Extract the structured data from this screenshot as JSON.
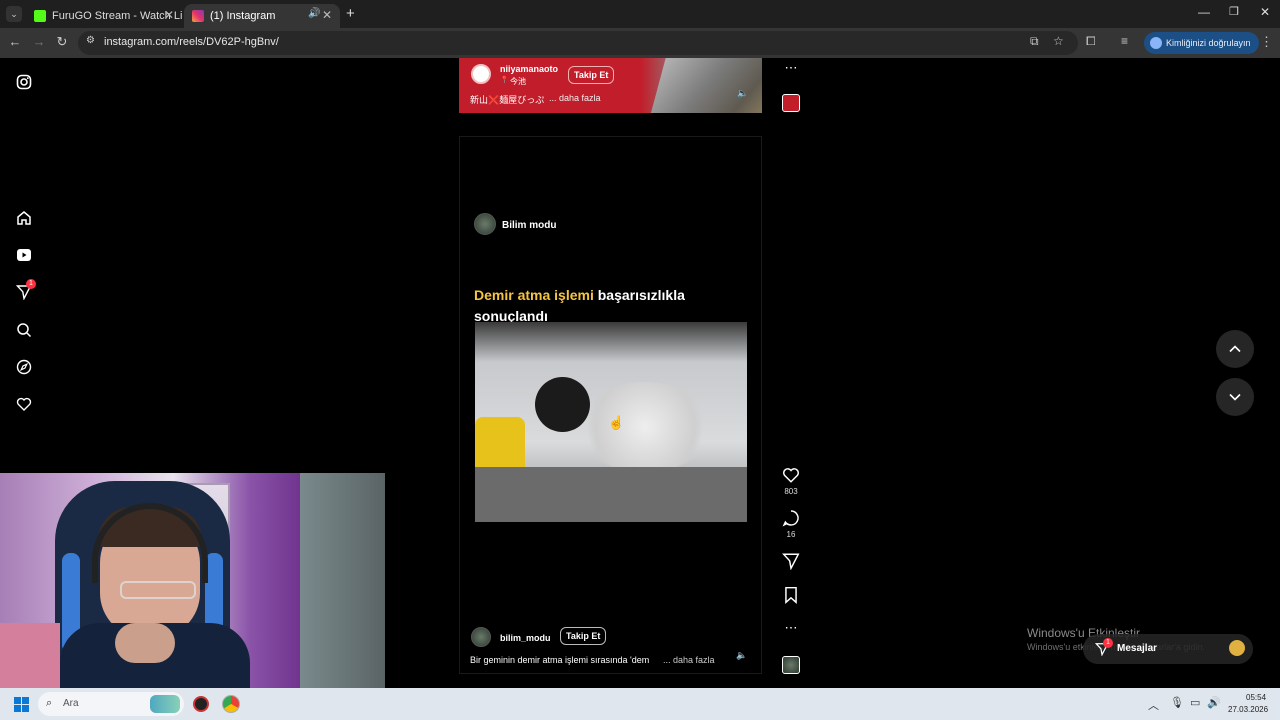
{
  "browser": {
    "tabs": [
      {
        "title": "FuruGO Stream - Watch Live o",
        "active": false
      },
      {
        "title": "(1) Instagram",
        "active": true
      }
    ],
    "new_tab": "+",
    "url": "instagram.com/reels/DV62P-hgBnv/",
    "verify_label": "Kimliğinizi doğrulayın"
  },
  "sidebar": {
    "notification_badge": "1"
  },
  "reel_top": {
    "username": "niiyamanaoto",
    "location": "今池",
    "follow": "Takip Et",
    "caption": "新山❌麺屋びっぷ",
    "more": "... daha fazla"
  },
  "reel_main": {
    "channel": "Bilim modu",
    "headline_highlight": "Demir atma işlemi",
    "headline_rest": " başarısızlıkla",
    "headline_line2": "sonuçlandı",
    "username": "bilim_modu",
    "follow": "Takip Et",
    "caption": "Bir geminin demir atma işlemi sırasında 'dem",
    "more": "... daha fazla"
  },
  "actions": {
    "likes": "803",
    "comments": "16"
  },
  "overlay": {
    "activate_title": "Windows'u Etkinleştir",
    "activate_sub": "Windows'u etkinleştirmek için Ayarlar'a gidin.",
    "messages_label": "Mesajlar",
    "messages_badge": "1"
  },
  "taskbar": {
    "search_placeholder": "Ara",
    "time": "05:54",
    "date": "27.03.2026"
  },
  "colors": {
    "accent_yellow": "#f5c542",
    "verify_blue": "#1c4f86",
    "badge_red": "#ff3040"
  }
}
